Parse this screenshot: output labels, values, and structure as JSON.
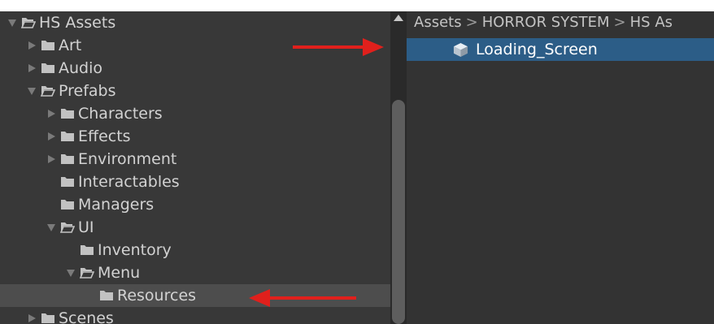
{
  "tree": {
    "root": {
      "label": "HS Assets",
      "expanded": true
    },
    "items": [
      {
        "label": "Art",
        "depth": 1,
        "arrow": "right",
        "open": false,
        "selected": false
      },
      {
        "label": "Audio",
        "depth": 1,
        "arrow": "right",
        "open": false,
        "selected": false
      },
      {
        "label": "Prefabs",
        "depth": 1,
        "arrow": "down",
        "open": true,
        "selected": false
      },
      {
        "label": "Characters",
        "depth": 2,
        "arrow": "right",
        "open": false,
        "selected": false
      },
      {
        "label": "Effects",
        "depth": 2,
        "arrow": "right",
        "open": false,
        "selected": false
      },
      {
        "label": "Environment",
        "depth": 2,
        "arrow": "right",
        "open": false,
        "selected": false
      },
      {
        "label": "Interactables",
        "depth": 2,
        "arrow": "none",
        "open": false,
        "selected": false
      },
      {
        "label": "Managers",
        "depth": 2,
        "arrow": "none",
        "open": false,
        "selected": false
      },
      {
        "label": "UI",
        "depth": 2,
        "arrow": "down",
        "open": true,
        "selected": false
      },
      {
        "label": "Inventory",
        "depth": 3,
        "arrow": "none",
        "open": false,
        "selected": false
      },
      {
        "label": "Menu",
        "depth": 3,
        "arrow": "down",
        "open": true,
        "selected": false
      },
      {
        "label": "Resources",
        "depth": 4,
        "arrow": "none",
        "open": false,
        "selected": true
      },
      {
        "label": "Scenes",
        "depth": 1,
        "arrow": "right",
        "open": false,
        "selected": false
      }
    ]
  },
  "breadcrumb": {
    "parts": [
      "Assets",
      "HORROR SYSTEM",
      "HS As"
    ],
    "separator": ">"
  },
  "asset_list": {
    "items": [
      {
        "label": "Loading_Screen",
        "icon": "prefab-cube-icon",
        "selected": true
      }
    ]
  },
  "colors": {
    "panel": "#383838",
    "selected_folder": "#4d4d4d",
    "selected_asset": "#2c5d87",
    "annotation_arrow": "#e0201c"
  }
}
